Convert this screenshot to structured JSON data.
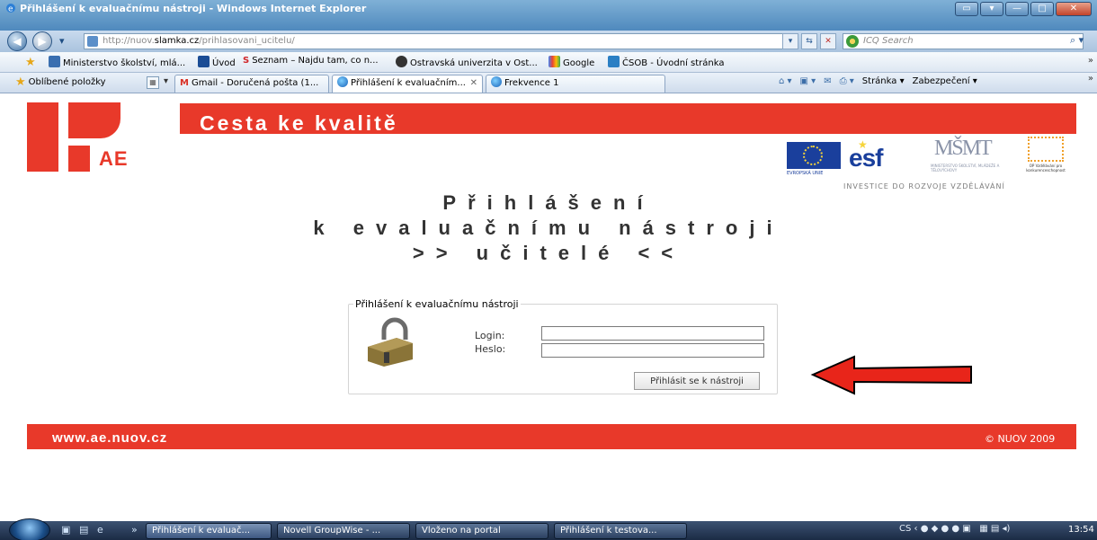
{
  "window": {
    "title": "Přihlášení k evaluačnímu nástroji - Windows Internet Explorer",
    "controls": [
      "▭",
      "▾",
      "—",
      "□",
      "✕"
    ]
  },
  "addressbar": {
    "url_prefix": "http://nuov.",
    "url_domain": "slamka.cz",
    "url_path": "/prihlasovani_ucitelu/",
    "search_placeholder": "ICQ Search"
  },
  "links": [
    {
      "label": "Ministerstvo školství, mlá...",
      "color": "#3a6fb0"
    },
    {
      "label": "Úvod",
      "color": "#1b4d95"
    },
    {
      "label": "Seznam – Najdu tam, co n...",
      "color": "#d0272b"
    },
    {
      "label": "Ostravská univerzita v Ost...",
      "color": "#333333"
    },
    {
      "label": "Google",
      "color": "#4a9c3a"
    },
    {
      "label": "ČSOB - Úvodní stránka",
      "color": "#2a7fc4"
    }
  ],
  "favorites": {
    "label": "Oblíbené položky"
  },
  "tabs": [
    {
      "label": "Gmail - Doručená pošta (1..."
    },
    {
      "label": "Přihlášení k evaluačním...",
      "close": "✕"
    },
    {
      "label": "Frekvence 1"
    }
  ],
  "commandbar": {
    "page_label": "Stránka",
    "security_label": "Zabezpečení"
  },
  "site": {
    "logo_text": "AE",
    "banner_text": "Cesta ke kvalitě",
    "eu_label": "EVROPSKÁ UNIE",
    "esf_text": "esf",
    "msmt_text": "MŠMT",
    "msmt_sub": "MINISTERSTVO ŠKOLSTVÍ, MLÁDEŽE A TĚLOVÝCHOVY",
    "op_text": "OP Vzdělávání pro konkurenceschopnost",
    "tagline": "INVESTICE DO ROZVOJE VZDĚLÁVÁNÍ",
    "heading_line1": "Přihlášení",
    "heading_line2": "k  evaluačnímu  nástroji",
    "heading_line3": ">> učitelé <<"
  },
  "login": {
    "legend": "Přihlášení k evaluačnímu nástroji",
    "login_label": "Login:",
    "login_value": "",
    "password_label": "Heslo:",
    "password_value": "",
    "submit_label": "Přihlásit se k nástroji"
  },
  "footer": {
    "url": "www.ae.nuov.cz",
    "copyright": "© NUOV 2009"
  },
  "taskbar": {
    "tasks": [
      {
        "label": "Přihlášení k evaluač..."
      },
      {
        "label": "Novell GroupWise - ..."
      },
      {
        "label": "Vloženo na portal"
      },
      {
        "label": "Přihlášení k testova..."
      }
    ],
    "language": "CS",
    "clock": "13:54"
  },
  "colors": {
    "brand_red": "#e8392a",
    "eu_blue": "#1a3f9c"
  }
}
